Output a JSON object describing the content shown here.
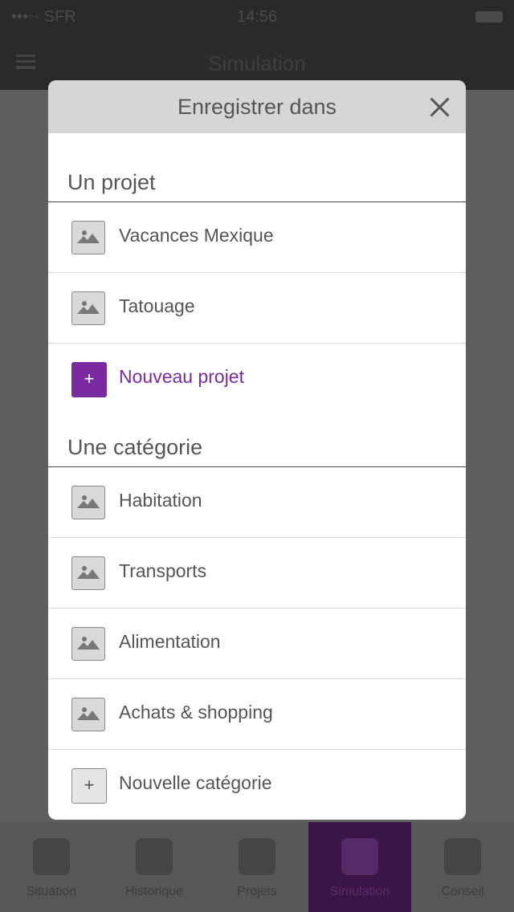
{
  "status_bar": {
    "carrier": "•••◦◦ SFR",
    "time": "14:56"
  },
  "app_header": {
    "title": "Simulation"
  },
  "tabbar": [
    {
      "label": "Situation"
    },
    {
      "label": "Historique"
    },
    {
      "label": "Projets"
    },
    {
      "label": "Simulation",
      "active": true
    },
    {
      "label": "Conseil"
    }
  ],
  "modal": {
    "title": "Enregistrer dans",
    "projects_section": {
      "title": "Un projet",
      "items": [
        {
          "label": "Vacances Mexique",
          "icon": "image-icon"
        },
        {
          "label": "Tatouage",
          "icon": "image-icon"
        }
      ],
      "new_label": "Nouveau projet"
    },
    "categories_section": {
      "title": "Une catégorie",
      "items": [
        {
          "label": "Habitation",
          "icon": "image-icon"
        },
        {
          "label": "Transports",
          "icon": "image-icon"
        },
        {
          "label": "Alimentation",
          "icon": "image-icon"
        },
        {
          "label": "Achats & shopping",
          "icon": "image-icon"
        }
      ],
      "new_label": "Nouvelle catégorie"
    },
    "plus_glyph": "+"
  },
  "colors": {
    "accent": "#7a2aa0",
    "header_bg": "#d6d6d6",
    "text": "#555555"
  }
}
